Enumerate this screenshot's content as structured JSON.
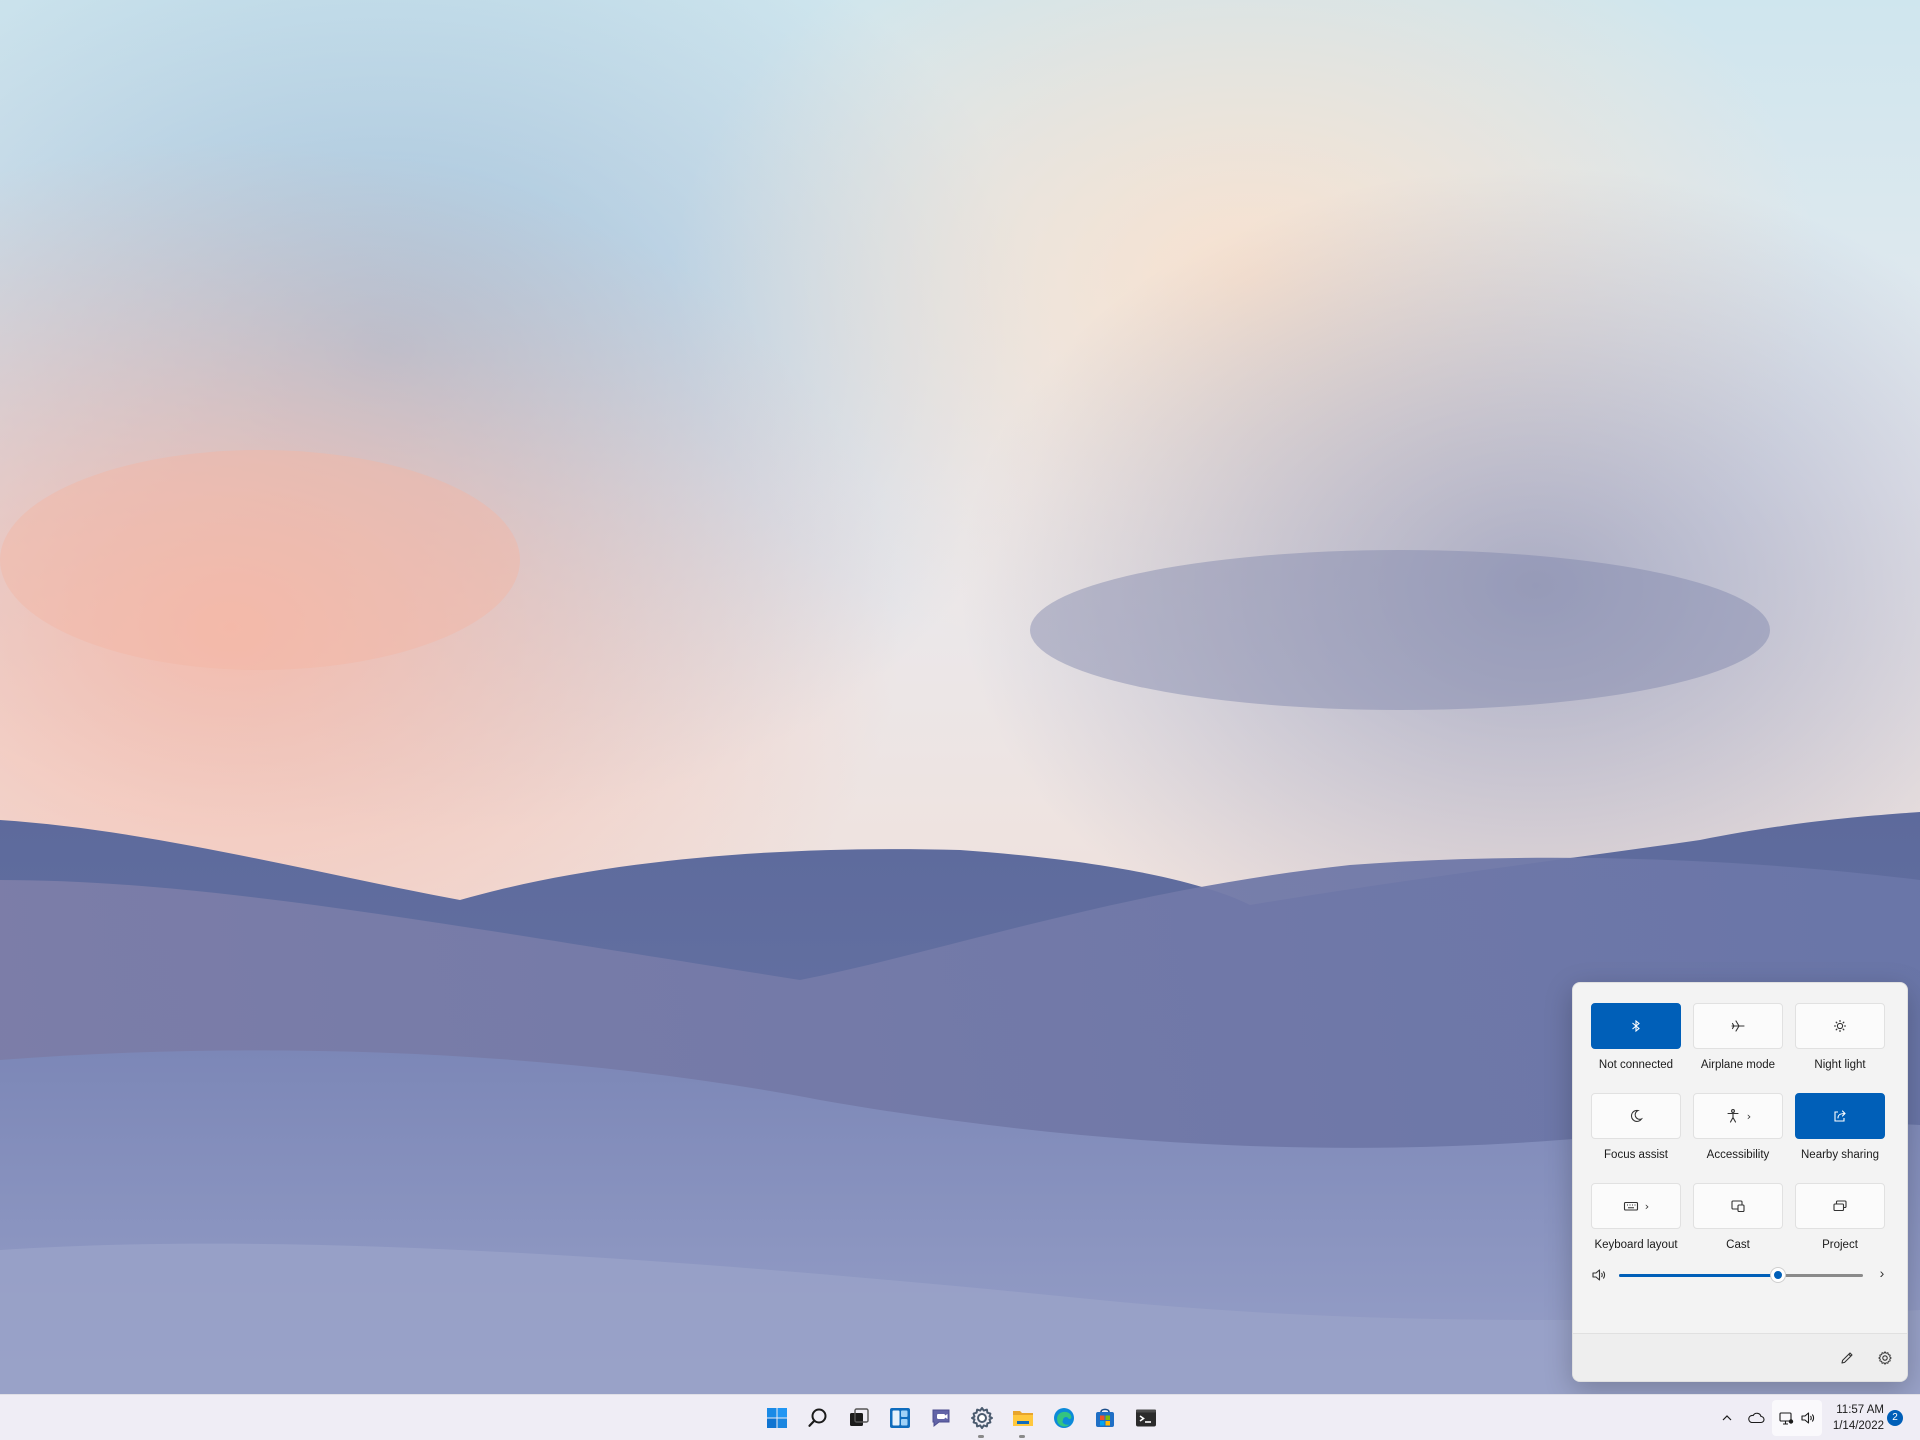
{
  "quick_settings": {
    "tiles": [
      {
        "label": "Not connected",
        "icon": "bluetooth-icon",
        "active": true
      },
      {
        "label": "Airplane mode",
        "icon": "airplane-icon",
        "active": false
      },
      {
        "label": "Night light",
        "icon": "brightness-icon",
        "active": false
      },
      {
        "label": "Focus assist",
        "icon": "moon-icon",
        "active": false
      },
      {
        "label": "Accessibility",
        "icon": "accessibility-icon",
        "active": false,
        "has_more": true
      },
      {
        "label": "Nearby sharing",
        "icon": "share-icon",
        "active": true
      },
      {
        "label": "Keyboard layout",
        "icon": "keyboard-icon",
        "active": false,
        "has_more": true
      },
      {
        "label": "Cast",
        "icon": "cast-icon",
        "active": false
      },
      {
        "label": "Project",
        "icon": "project-icon",
        "active": false
      }
    ],
    "volume_level": 0.65,
    "footer": {
      "edit_icon": "pencil-icon",
      "settings_icon": "gear-icon"
    }
  },
  "taskbar": {
    "apps": [
      "windows-start-icon",
      "search-icon",
      "task-view-icon",
      "widgets-icon",
      "teams-chat-icon",
      "settings-icon",
      "file-explorer-icon",
      "edge-icon",
      "store-icon",
      "terminal-icon"
    ],
    "running": [
      "settings-icon",
      "file-explorer-icon"
    ]
  },
  "tray": {
    "time": "11:57 AM",
    "date": "1/14/2022",
    "notification_count": "2"
  },
  "colors": {
    "accent": "#005fb8",
    "flyout_bg": "#f3f3f3"
  }
}
